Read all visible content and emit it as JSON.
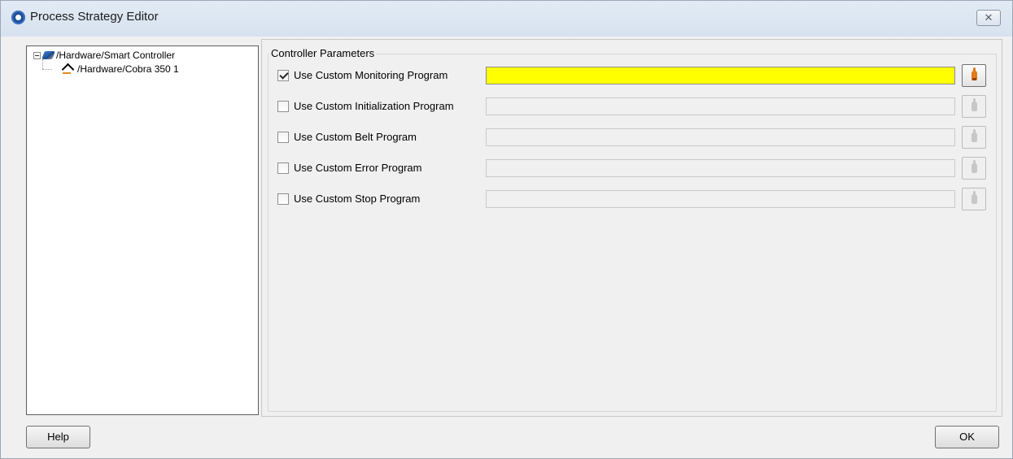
{
  "window": {
    "title": "Process Strategy Editor",
    "close_symbol": "✕"
  },
  "tree": {
    "items": [
      {
        "label": "/Hardware/Smart Controller",
        "icon": "controller-icon",
        "expanded": true
      },
      {
        "label": "/Hardware/Cobra 350 1",
        "icon": "robot-icon",
        "expanded": false
      }
    ]
  },
  "parameters": {
    "group_title": "Controller Parameters",
    "rows": [
      {
        "label": "Use Custom Monitoring Program",
        "checked": true,
        "value": ""
      },
      {
        "label": "Use Custom Initialization Program",
        "checked": false,
        "value": ""
      },
      {
        "label": "Use Custom Belt Program",
        "checked": false,
        "value": ""
      },
      {
        "label": "Use Custom Error Program",
        "checked": false,
        "value": ""
      },
      {
        "label": "Use Custom Stop Program",
        "checked": false,
        "value": ""
      }
    ]
  },
  "footer": {
    "help_label": "Help",
    "ok_label": "OK"
  },
  "colors": {
    "highlight_field": "#ffff00",
    "active_pointer": "#e07b1c"
  },
  "icons": {
    "app": "app-logo-icon",
    "close": "close-icon",
    "browse": "pointer-icon"
  }
}
